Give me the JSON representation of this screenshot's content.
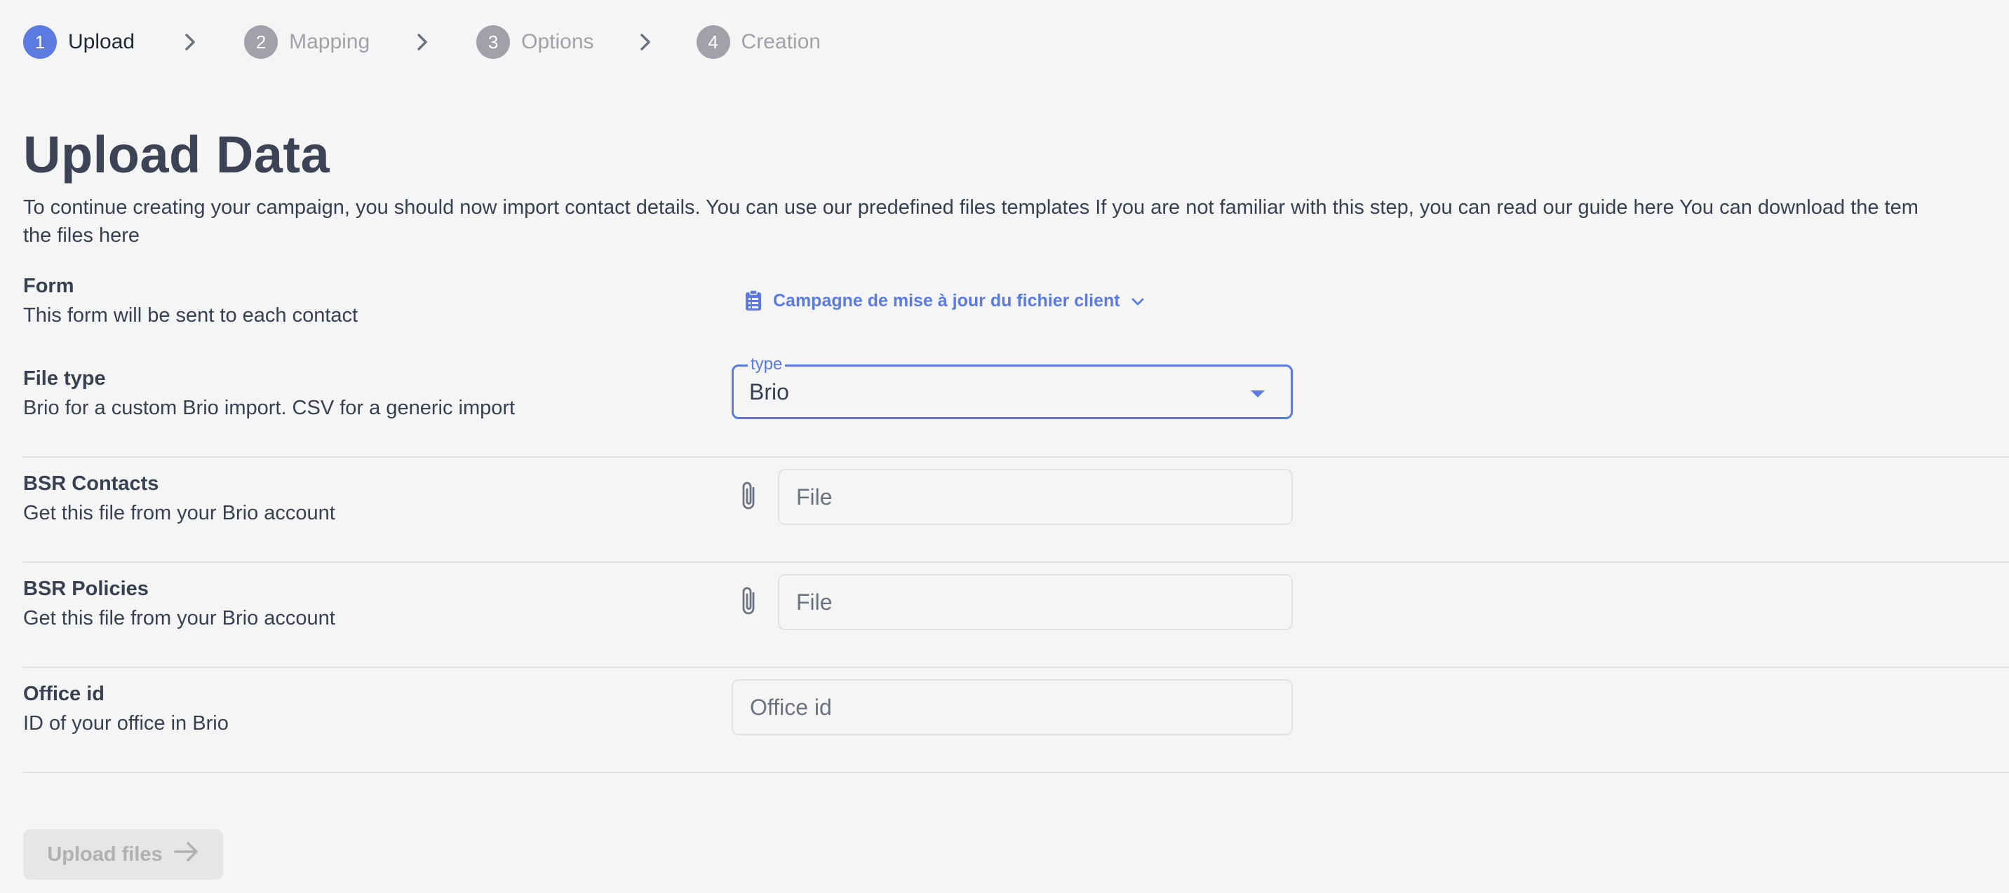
{
  "stepper": {
    "steps": [
      {
        "number": "1",
        "label": "Upload",
        "state": "active"
      },
      {
        "number": "2",
        "label": "Mapping",
        "state": "inactive"
      },
      {
        "number": "3",
        "label": "Options",
        "state": "inactive"
      },
      {
        "number": "4",
        "label": "Creation",
        "state": "inactive"
      }
    ]
  },
  "page": {
    "title": "Upload Data",
    "intro": "To continue creating your campaign, you should now import contact details. You can use our predefined files templates If you are not familiar with this step, you can read our guide here You can download the tem",
    "intro_line2": "the files here"
  },
  "form_row": {
    "label": "Form",
    "description": "This form will be sent to each contact",
    "selected_form": "Campagne de mise à jour du fichier client",
    "icon": "clipboard-icon"
  },
  "file_type_row": {
    "label": "File type",
    "description": "Brio for a custom Brio import. CSV for a generic import",
    "field_legend": "type",
    "value": "Brio"
  },
  "contacts_row": {
    "label": "BSR Contacts",
    "description": "Get this file from your Brio account",
    "placeholder": "File",
    "icon": "paperclip-icon"
  },
  "policies_row": {
    "label": "BSR Policies",
    "description": "Get this file from your Brio account",
    "placeholder": "File",
    "icon": "paperclip-icon"
  },
  "office_row": {
    "label": "Office id",
    "description": "ID of your office in Brio",
    "placeholder": "Office id"
  },
  "actions": {
    "upload_label": "Upload files",
    "upload_disabled": true
  },
  "colors": {
    "accent": "#5b7be0",
    "inactive_step": "#a1a1aa",
    "background": "#f5f5f5",
    "text": "#374151"
  }
}
